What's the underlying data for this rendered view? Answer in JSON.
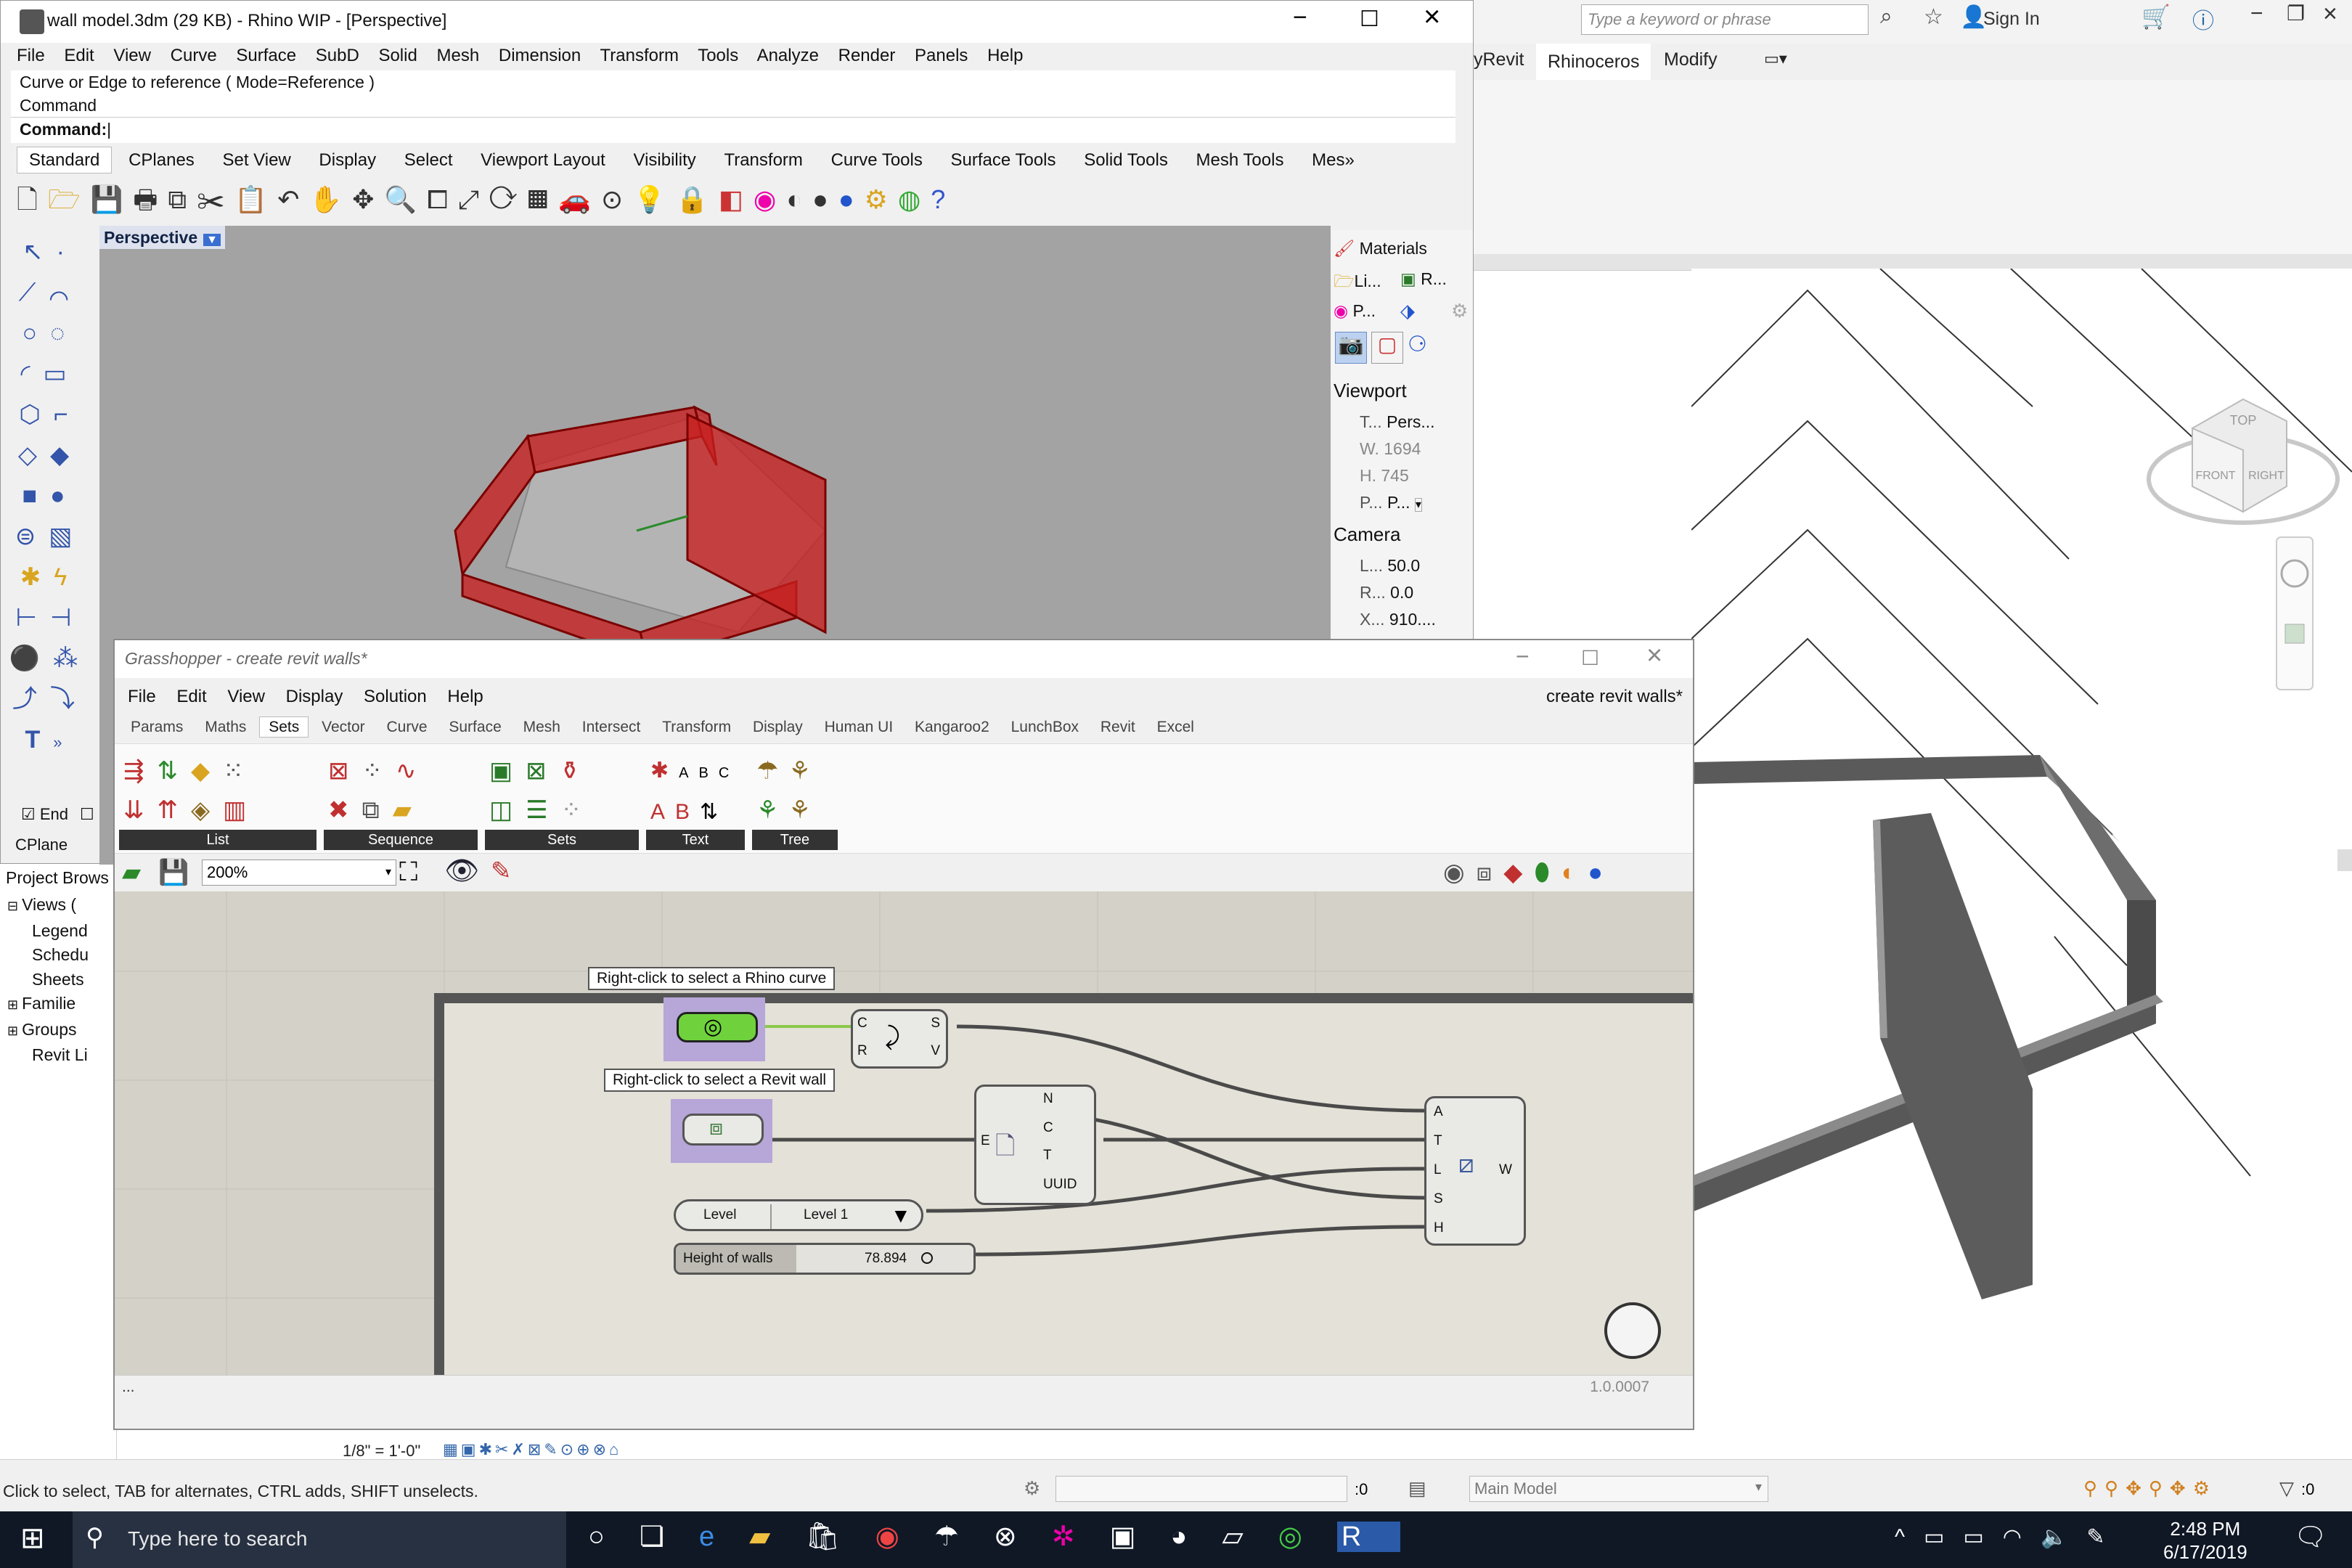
{
  "revit": {
    "search_placeholder": "Type a keyword or phrase",
    "sign_in": "Sign In",
    "tabs": [
      "yRevit",
      "Rhinoceros",
      "Modify"
    ],
    "project_browser_title": "Project Brows",
    "browser_items": [
      "Views (",
      "Legend",
      "Schedu",
      "Sheets",
      "Familie",
      "Groups",
      "Revit Li"
    ],
    "scale": "1/8\" = 1'-0\"",
    "status_text": "Click to select, TAB for alternates, CTRL adds, SHIFT unselects.",
    "model_name": "Main Model",
    "filter_count": ":0",
    "workset_count": ":0",
    "viewcube_labels": [
      "TOP",
      "FRONT",
      "RIGHT"
    ]
  },
  "rhino": {
    "title": "wall model.3dm (29 KB) - Rhino WIP - [Perspective]",
    "menu": [
      "File",
      "Edit",
      "View",
      "Curve",
      "Surface",
      "SubD",
      "Solid",
      "Mesh",
      "Dimension",
      "Transform",
      "Tools",
      "Analyze",
      "Render",
      "Panels",
      "Help"
    ],
    "cmd_line1": "Curve or Edge to reference ( Mode=Reference )",
    "cmd_line2": "Command",
    "cmd_prompt": "Command:",
    "toolbar_tabs": [
      "Standard",
      "CPlanes",
      "Set View",
      "Display",
      "Select",
      "Viewport Layout",
      "Visibility",
      "Transform",
      "Curve Tools",
      "Surface Tools",
      "Solid Tools",
      "Mesh Tools",
      "Mes»"
    ],
    "viewport_label": "Perspective",
    "panel": {
      "materials": "Materials",
      "libraries": "Li...",
      "render": "R...",
      "properties": "P...",
      "viewport_header": "Viewport",
      "viewport_rows": [
        [
          "T...",
          "Pers..."
        ],
        [
          "W.",
          "1694"
        ],
        [
          "H.",
          "745"
        ],
        [
          "P...",
          "P..."
        ]
      ],
      "camera_header": "Camera",
      "camera_rows": [
        [
          "L...",
          "50.0"
        ],
        [
          "R...",
          "0.0"
        ],
        [
          "X...",
          "910...."
        ]
      ]
    },
    "end_label": "End",
    "cplane_label": "CPlane"
  },
  "grasshopper": {
    "title": "Grasshopper - create revit walls*",
    "doc_name": "create revit walls*",
    "menu": [
      "File",
      "Edit",
      "View",
      "Display",
      "Solution",
      "Help"
    ],
    "tabs": [
      "Params",
      "Maths",
      "Sets",
      "Vector",
      "Curve",
      "Surface",
      "Mesh",
      "Intersect",
      "Transform",
      "Display",
      "Human UI",
      "Kangaroo2",
      "LunchBox",
      "Revit",
      "Excel"
    ],
    "active_tab": "Sets",
    "groups": [
      "List",
      "Sequence",
      "Sets",
      "Text",
      "Tree"
    ],
    "zoom": "200%",
    "status": "...",
    "version": "1.0.0007",
    "tooltip_curve": "Right-click to select a Rhino curve",
    "tooltip_wall": "Right-click to select a Revit wall",
    "level_label": "Level",
    "level_value": "Level 1",
    "slider_label": "Height of walls",
    "slider_value": "78.894",
    "comp_cs_inputs": [
      "C",
      "R"
    ],
    "comp_cs_outputs": [
      "S",
      "V"
    ],
    "comp_elem_input": "E",
    "comp_elem_outputs": [
      "N",
      "C",
      "T",
      "UUID"
    ],
    "comp_wall_inputs": [
      "A",
      "T",
      "L",
      "S",
      "H"
    ],
    "comp_wall_output": "W"
  },
  "taskbar": {
    "search_placeholder": "Type here to search",
    "time": "2:48 PM",
    "date": "6/17/2019"
  }
}
